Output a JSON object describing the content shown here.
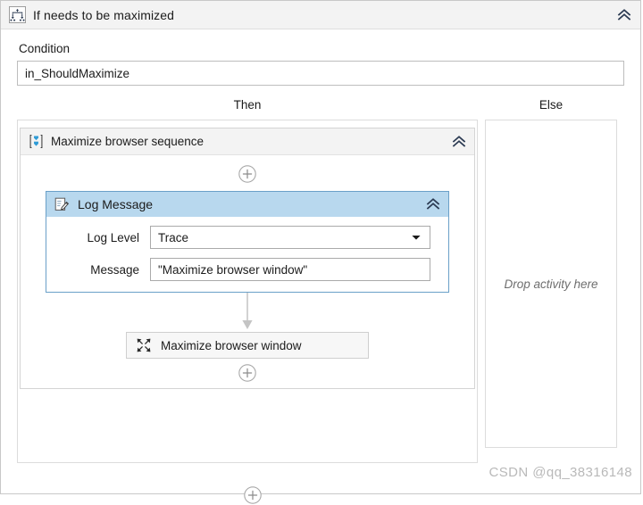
{
  "activity": {
    "title": "If needs to be maximized",
    "icon": "if-branch-icon",
    "collapse_icon": "double-chevron-up-icon",
    "condition_label": "Condition",
    "condition_value": "in_ShouldMaximize",
    "then_label": "Then",
    "else_label": "Else"
  },
  "then_branch": {
    "sequence": {
      "title": "Maximize browser sequence",
      "icon": "sequence-icon",
      "collapse_icon": "double-chevron-up-icon",
      "add_top_label": "+",
      "add_bottom_label": "+",
      "log_message": {
        "title": "Log Message",
        "icon": "log-message-pencil-icon",
        "collapse_icon": "double-chevron-up-icon",
        "fields": [
          {
            "label": "Log Level",
            "value": "Trace",
            "type": "dropdown",
            "name": "log-level"
          },
          {
            "label": "Message",
            "value": "\"Maximize browser window\"",
            "type": "textbox",
            "name": "message"
          }
        ]
      },
      "maximize_activity": {
        "title": "Maximize browser window",
        "icon": "maximize-arrows-icon"
      }
    }
  },
  "else_branch": {
    "drop_hint": "Drop activity here"
  },
  "watermark": {
    "text": "CSDN @qq_38316148"
  },
  "colors": {
    "log_message_header": "#b8d8ee",
    "log_message_border": "#6aa0c8",
    "titlebar": "#f3f3f3",
    "sequence_icon_blue": "#2e9bd6",
    "chevron": "#2b3a52"
  }
}
